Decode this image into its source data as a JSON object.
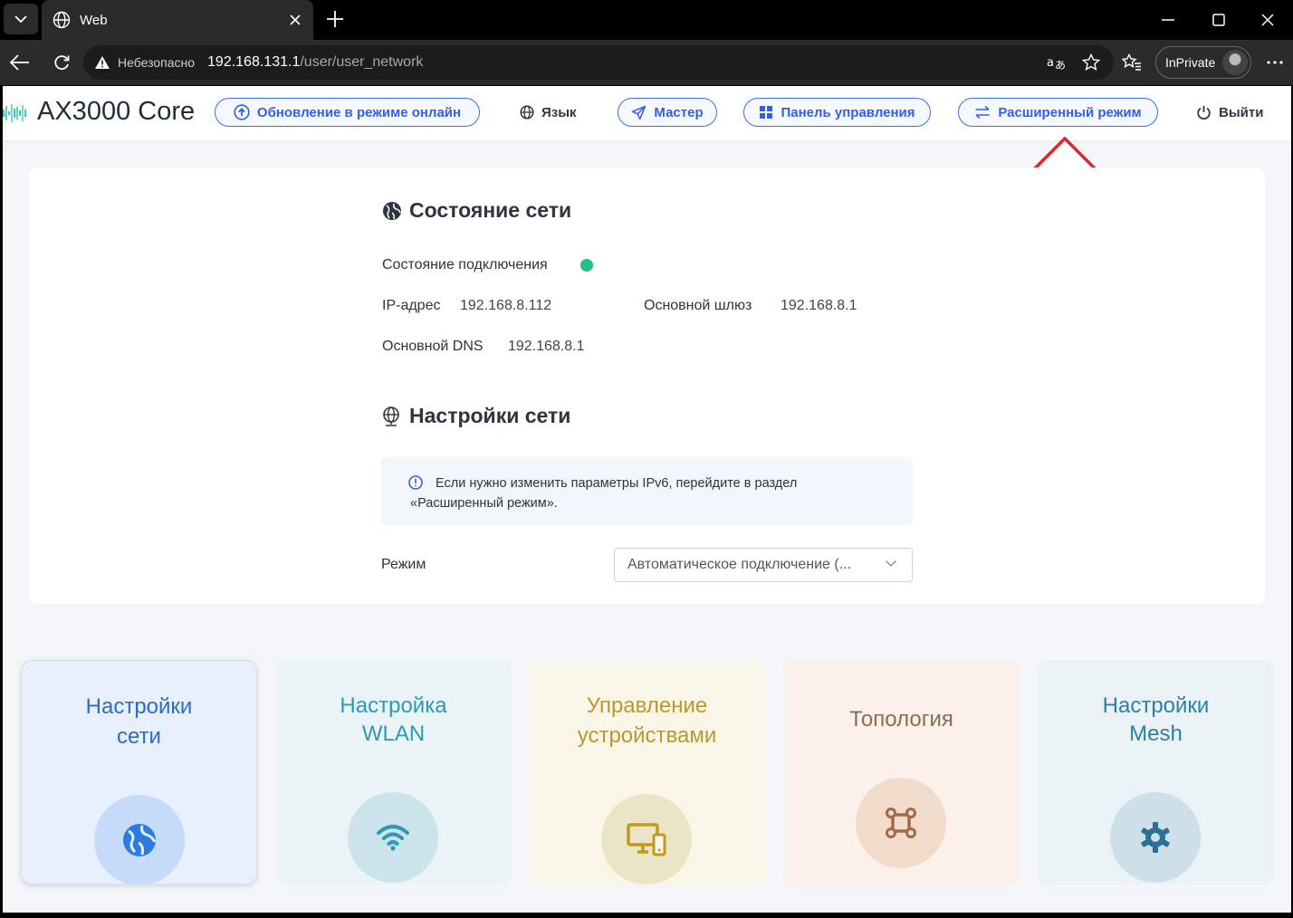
{
  "browser": {
    "tab_title": "Web",
    "security_label": "Небезопасно",
    "url_host": "192.168.131.1",
    "url_path": "/user/user_network",
    "inprivate_label": "InPrivate"
  },
  "header": {
    "brand": "AX3000 Core",
    "online_update": "Обновление в режиме онлайн",
    "language": "Язык",
    "wizard": "Мастер",
    "dashboard": "Панель управления",
    "advanced_mode": "Расширенный режим",
    "logout": "Выйти"
  },
  "network_status": {
    "title": "Состояние сети",
    "connection_label": "Состояние подключения",
    "ip_label": "IP-адрес",
    "ip_value": "192.168.8.112",
    "gateway_label": "Основной шлюз",
    "gateway_value": "192.168.8.1",
    "dns_label": "Основной DNS",
    "dns_value": "192.168.8.1",
    "status_color": "#22c08a"
  },
  "network_settings": {
    "title": "Настройки сети",
    "notice_line1": "Если нужно изменить параметры IPv6, перейдите в раздел",
    "notice_line2": "«Расширенный режим».",
    "mode_label": "Режим",
    "mode_value": "Автоматическое подключение (..."
  },
  "tiles": [
    {
      "line1": "Настройки",
      "line2": "сети",
      "icon": "globe-icon"
    },
    {
      "line1": "Настройка",
      "line2": "WLAN",
      "icon": "wifi-icon"
    },
    {
      "line1": "Управление",
      "line2": "устройствами",
      "icon": "devices-icon"
    },
    {
      "line1": "Топология",
      "line2": "",
      "icon": "topology-icon"
    },
    {
      "line1": "Настройки",
      "line2": "Mesh",
      "icon": "gear-icon"
    }
  ],
  "colors": {
    "accent": "#3160e0",
    "annotation_arrow": "#e0242b"
  }
}
